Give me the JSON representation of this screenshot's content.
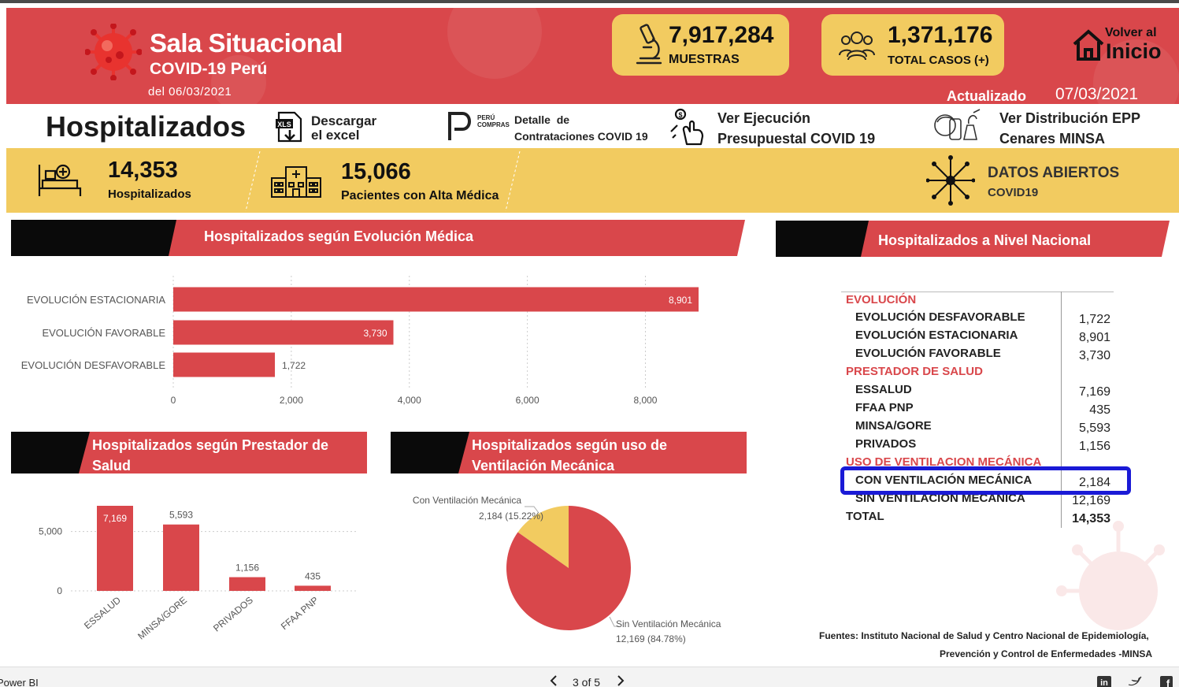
{
  "header": {
    "title": "Sala Situacional",
    "subtitle": "COVID-19 Perú",
    "date": "del 06/03/2021",
    "kpis": [
      {
        "value": "7,917,284",
        "label": "MUESTRAS",
        "icon": "microscope-icon"
      },
      {
        "value": "1,371,176",
        "label": "TOTAL CASOS (+)",
        "icon": "people-group-icon"
      }
    ],
    "home": {
      "top": "Volver al",
      "main": "Inicio",
      "icon": "home-icon"
    },
    "updated_label": "Actualizado",
    "updated_date": "07/03/2021"
  },
  "actions": {
    "page_title": "Hospitalizados",
    "excel": {
      "line1": "Descargar",
      "line2": "el excel",
      "icon": "excel-download-icon",
      "badge": "XLS"
    },
    "peru_compras": {
      "logo_text_1": "PERÚ",
      "logo_text_2": "COMPRAS",
      "line1": "Detalle  de",
      "line2": "Contrataciones COVID 19",
      "icon": "peru-compras-logo-icon"
    },
    "ejecucion": {
      "line1": "Ver Ejecución",
      "line2": "Presupuestal COVID 19",
      "icon": "hand-money-icon"
    },
    "epp": {
      "line1": "Ver Distribución EPP",
      "line2": "Cenares MINSA",
      "icon": "ppe-icon"
    }
  },
  "summary": {
    "hospitalizados": {
      "value": "14,353",
      "label": "Hospitalizados",
      "icon": "hospital-bed-icon"
    },
    "altas": {
      "value": "15,066",
      "label": "Pacientes con Alta Médica",
      "icon": "hospital-building-icon"
    },
    "datos_abiertos": {
      "title": "DATOS ABIERTOS",
      "sub": "COVID19",
      "icon": "network-icon"
    }
  },
  "sections": {
    "evolucion": "Hospitalizados según Evolución Médica",
    "nacional": "Hospitalizados a Nivel Nacional",
    "prestador_1": "Hospitalizados según Prestador de",
    "prestador_2": "Salud",
    "ventilacion_1": "Hospitalizados según uso de",
    "ventilacion_2": "Ventilación Mecánica"
  },
  "chart_data": [
    {
      "type": "bar",
      "orientation": "horizontal",
      "categories": [
        "EVOLUCIÓN ESTACIONARIA",
        "EVOLUCIÓN FAVORABLE",
        "EVOLUCIÓN DESFAVORABLE"
      ],
      "values": [
        8901,
        3730,
        1722
      ],
      "labels": [
        "8,901",
        "3,730",
        "1,722"
      ],
      "xticks": [
        "0",
        "2,000",
        "4,000",
        "6,000",
        "8,000"
      ],
      "xlim": [
        0,
        8901
      ],
      "color": "#d9474b",
      "grid": true
    },
    {
      "type": "bar",
      "categories": [
        "ESSALUD",
        "MINSA/GORE",
        "PRIVADOS",
        "FFAA PNP"
      ],
      "values": [
        7169,
        5593,
        1156,
        435
      ],
      "labels": [
        "7,169",
        "5,593",
        "1,156",
        "435"
      ],
      "yticks": [
        "0",
        "5,000"
      ],
      "ylim": [
        0,
        7169
      ],
      "color": "#d9474b"
    },
    {
      "type": "pie",
      "slices": [
        {
          "label": "Con Ventilación Mecánica",
          "value": 2184,
          "text": "2,184 (15.22%)",
          "color": "#f2cb60"
        },
        {
          "label": "Sin Ventilación Mecánica",
          "value": 12169,
          "text": "12,169 (84.78%)",
          "color": "#d9474b"
        }
      ]
    }
  ],
  "national_table": {
    "rows": [
      {
        "kind": "section",
        "label": "EVOLUCIÓN"
      },
      {
        "kind": "item",
        "label": "EVOLUCIÓN DESFAVORABLE",
        "value": "1,722"
      },
      {
        "kind": "item",
        "label": "EVOLUCIÓN ESTACIONARIA",
        "value": "8,901"
      },
      {
        "kind": "item",
        "label": "EVOLUCIÓN FAVORABLE",
        "value": "3,730"
      },
      {
        "kind": "section",
        "label": "PRESTADOR DE SALUD"
      },
      {
        "kind": "item",
        "label": "ESSALUD",
        "value": "7,169"
      },
      {
        "kind": "item",
        "label": "FFAA PNP",
        "value": "435"
      },
      {
        "kind": "item",
        "label": "MINSA/GORE",
        "value": "5,593"
      },
      {
        "kind": "item",
        "label": "PRIVADOS",
        "value": "1,156"
      },
      {
        "kind": "section",
        "label": "USO DE VENTILACION MECÁNICA"
      },
      {
        "kind": "item",
        "label": "CON VENTILACIÓN MECÁNICA",
        "value": "2,184"
      },
      {
        "kind": "item",
        "label": "SIN VENTILACIÓN MECÁNICA",
        "value": "12,169"
      },
      {
        "kind": "total",
        "label": "TOTAL",
        "value": "14,353"
      }
    ]
  },
  "sources": {
    "line1": "Fuentes: Instituto Nacional de Salud y Centro Nacional de Epidemiología,",
    "line2": "Prevención y Control de Enfermedades -MINSA"
  },
  "footer": {
    "app": "Power BI",
    "page": "3 of 5",
    "prev_icon": "chevron-left-icon",
    "next_icon": "chevron-right-icon",
    "social": [
      "linkedin-icon",
      "twitter-icon",
      "facebook-icon"
    ]
  },
  "colors": {
    "red": "#d9474b",
    "yellow": "#f2cb60",
    "black": "#0a0a0a",
    "highlight": "#1a1ad6"
  }
}
